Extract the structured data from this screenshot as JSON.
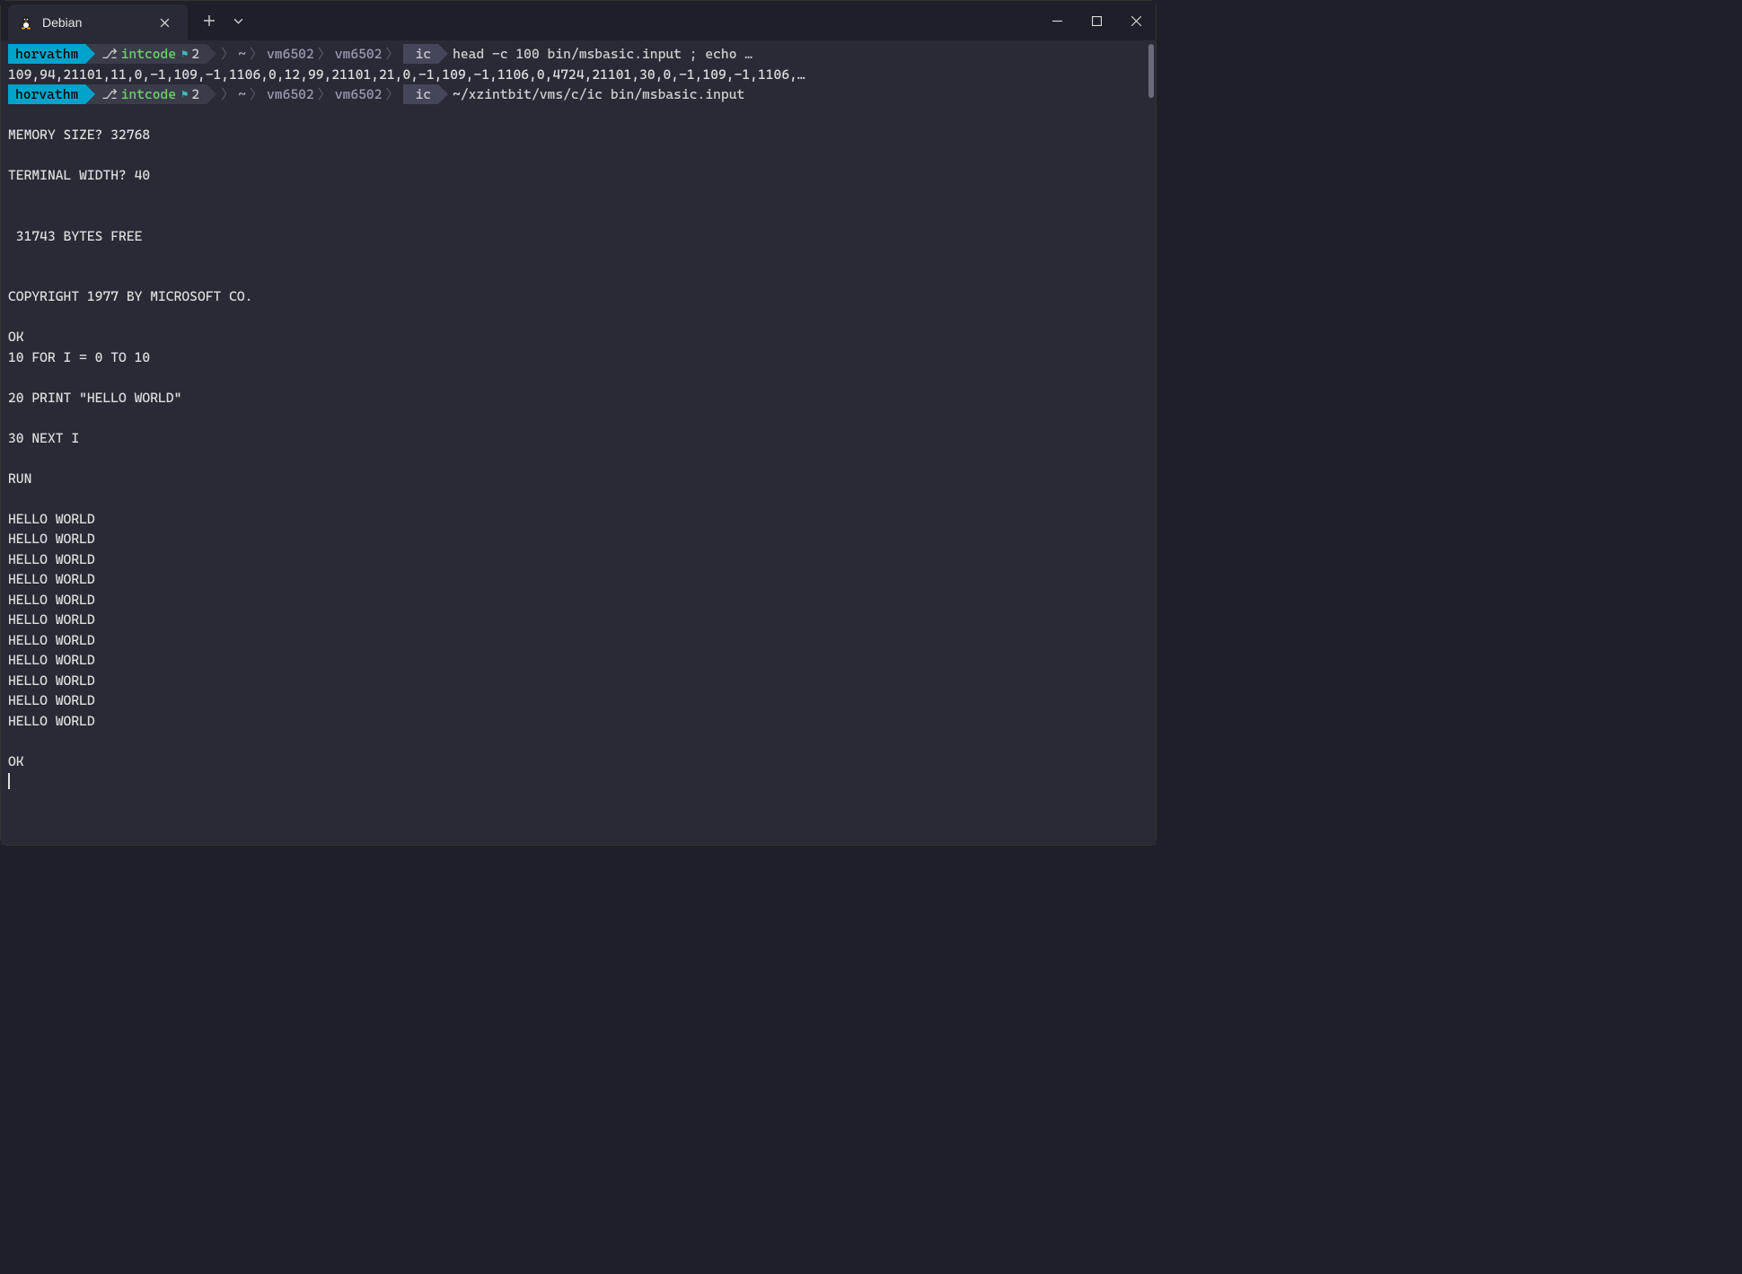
{
  "titlebar": {
    "tab_title": "Debian"
  },
  "prompt1": {
    "user": "horvathm",
    "branch": "intcode",
    "gitnum": "2",
    "path": [
      "~",
      "vm6502",
      "vm6502",
      "ic"
    ],
    "command": "head -c 100 bin/msbasic.input ; echo …"
  },
  "output1": "109,94,21101,11,0,-1,109,-1,1106,0,12,99,21101,21,0,-1,109,-1,1106,0,4724,21101,30,0,-1,109,-1,1106,…",
  "prompt2": {
    "user": "horvathm",
    "branch": "intcode",
    "gitnum": "2",
    "path": [
      "~",
      "vm6502",
      "vm6502",
      "ic"
    ],
    "command": "~/xzintbit/vms/c/ic bin/msbasic.input"
  },
  "output2": "\nMEMORY SIZE? 32768\n\nTERMINAL WIDTH? 40\n\n\n 31743 BYTES FREE\n\n\nCOPYRIGHT 1977 BY MICROSOFT CO.\n\nOK\n10 FOR I = 0 TO 10\n\n20 PRINT \"HELLO WORLD\"\n\n30 NEXT I\n\nRUN\n\nHELLO WORLD\nHELLO WORLD\nHELLO WORLD\nHELLO WORLD\nHELLO WORLD\nHELLO WORLD\nHELLO WORLD\nHELLO WORLD\nHELLO WORLD\nHELLO WORLD\nHELLO WORLD\n\nOK"
}
